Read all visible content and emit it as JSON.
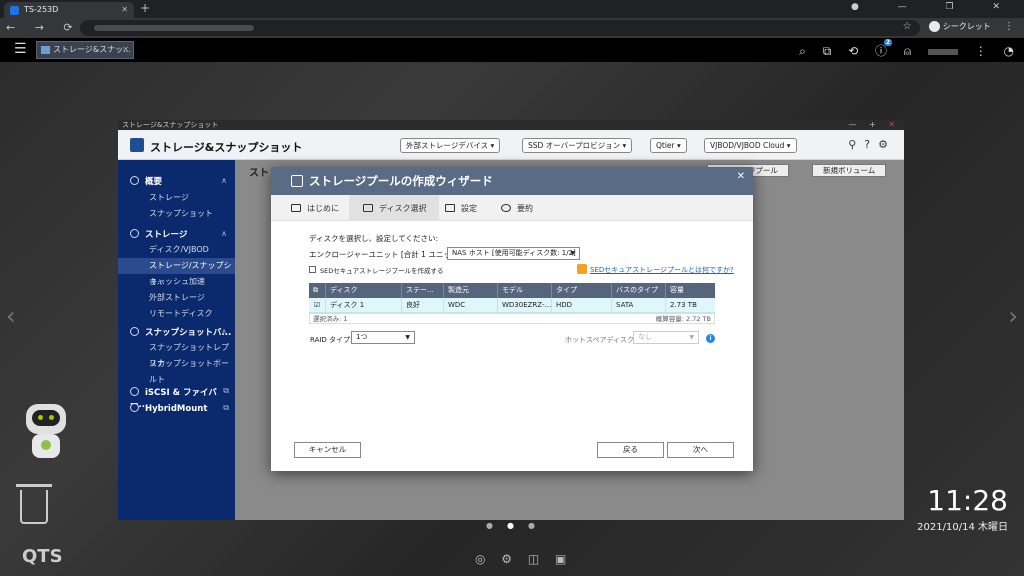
{
  "browser": {
    "tab_title": "TS-253D",
    "incognito_label": "シークレット"
  },
  "qts": {
    "task_label": "ストレージ&スナッ...",
    "notification_count": "2",
    "logo": "QTS",
    "clock": "11:28",
    "date": "2021/10/14 木曜日"
  },
  "window": {
    "titlebar": "ストレージ&スナップショット",
    "app_title": "ストレージ&スナップショット",
    "header_buttons": [
      "外部ストレージデバイス ▾",
      "SSD オーバープロビジョン ▾",
      "Qtier ▾",
      "VJBOD/VJBOD Cloud ▾"
    ],
    "content_title": "ストレ",
    "content_buttons": [
      "ストレージプール",
      "新規ボリューム"
    ]
  },
  "sidebar": {
    "sections": [
      {
        "label": "概要",
        "items": [
          "ストレージ",
          "スナップショット"
        ]
      },
      {
        "label": "ストレージ",
        "items": [
          "ディスク/VJBOD",
          "ストレージ/スナップショ...",
          "キャッシュ加速",
          "外部ストレージ",
          "リモートディスク"
        ]
      },
      {
        "label": "スナップショットバ...",
        "items": [
          "スナップショットレプリカ",
          "スナップショットボールト"
        ]
      },
      {
        "label": "iSCSI & ファイバー...",
        "items": []
      },
      {
        "label": "HybridMount",
        "items": []
      }
    ]
  },
  "wizard": {
    "title": "ストレージプールの作成ウィザード",
    "steps": [
      "はじめに",
      "ディスク選択",
      "設定",
      "要約"
    ],
    "instruction": "ディスクを選択し、設定してください:",
    "enclosure_label": "エンクロージャーユニット [合計 1 ユニット]:",
    "enclosure_value": "NAS ホスト [使用可能ディスク数: 1/2]",
    "sed_checkbox_label": "SEDセキュアストレージプールを作成する",
    "sed_link": "SEDセキュアストレージプールとは何ですか?",
    "table": {
      "columns": [
        "ディスク",
        "ステー...",
        "製造元",
        "モデル",
        "タイプ",
        "バスのタイプ",
        "容量"
      ],
      "rows": [
        [
          "ディスク 1",
          "良好",
          "WDC",
          "WD30EZRZ-...",
          "HDD",
          "SATA",
          "2.73 TB"
        ]
      ],
      "selected_label": "選択済み: 1",
      "estimated_label": "概算容量: 2.72 TB"
    },
    "raid_label": "RAID タイプ:",
    "raid_value": "1つ",
    "hotspare_label": "ホットスペアディスク:",
    "hotspare_value": "なし",
    "cancel_button": "キャンセル",
    "back_button": "戻る",
    "next_button": "次へ"
  }
}
